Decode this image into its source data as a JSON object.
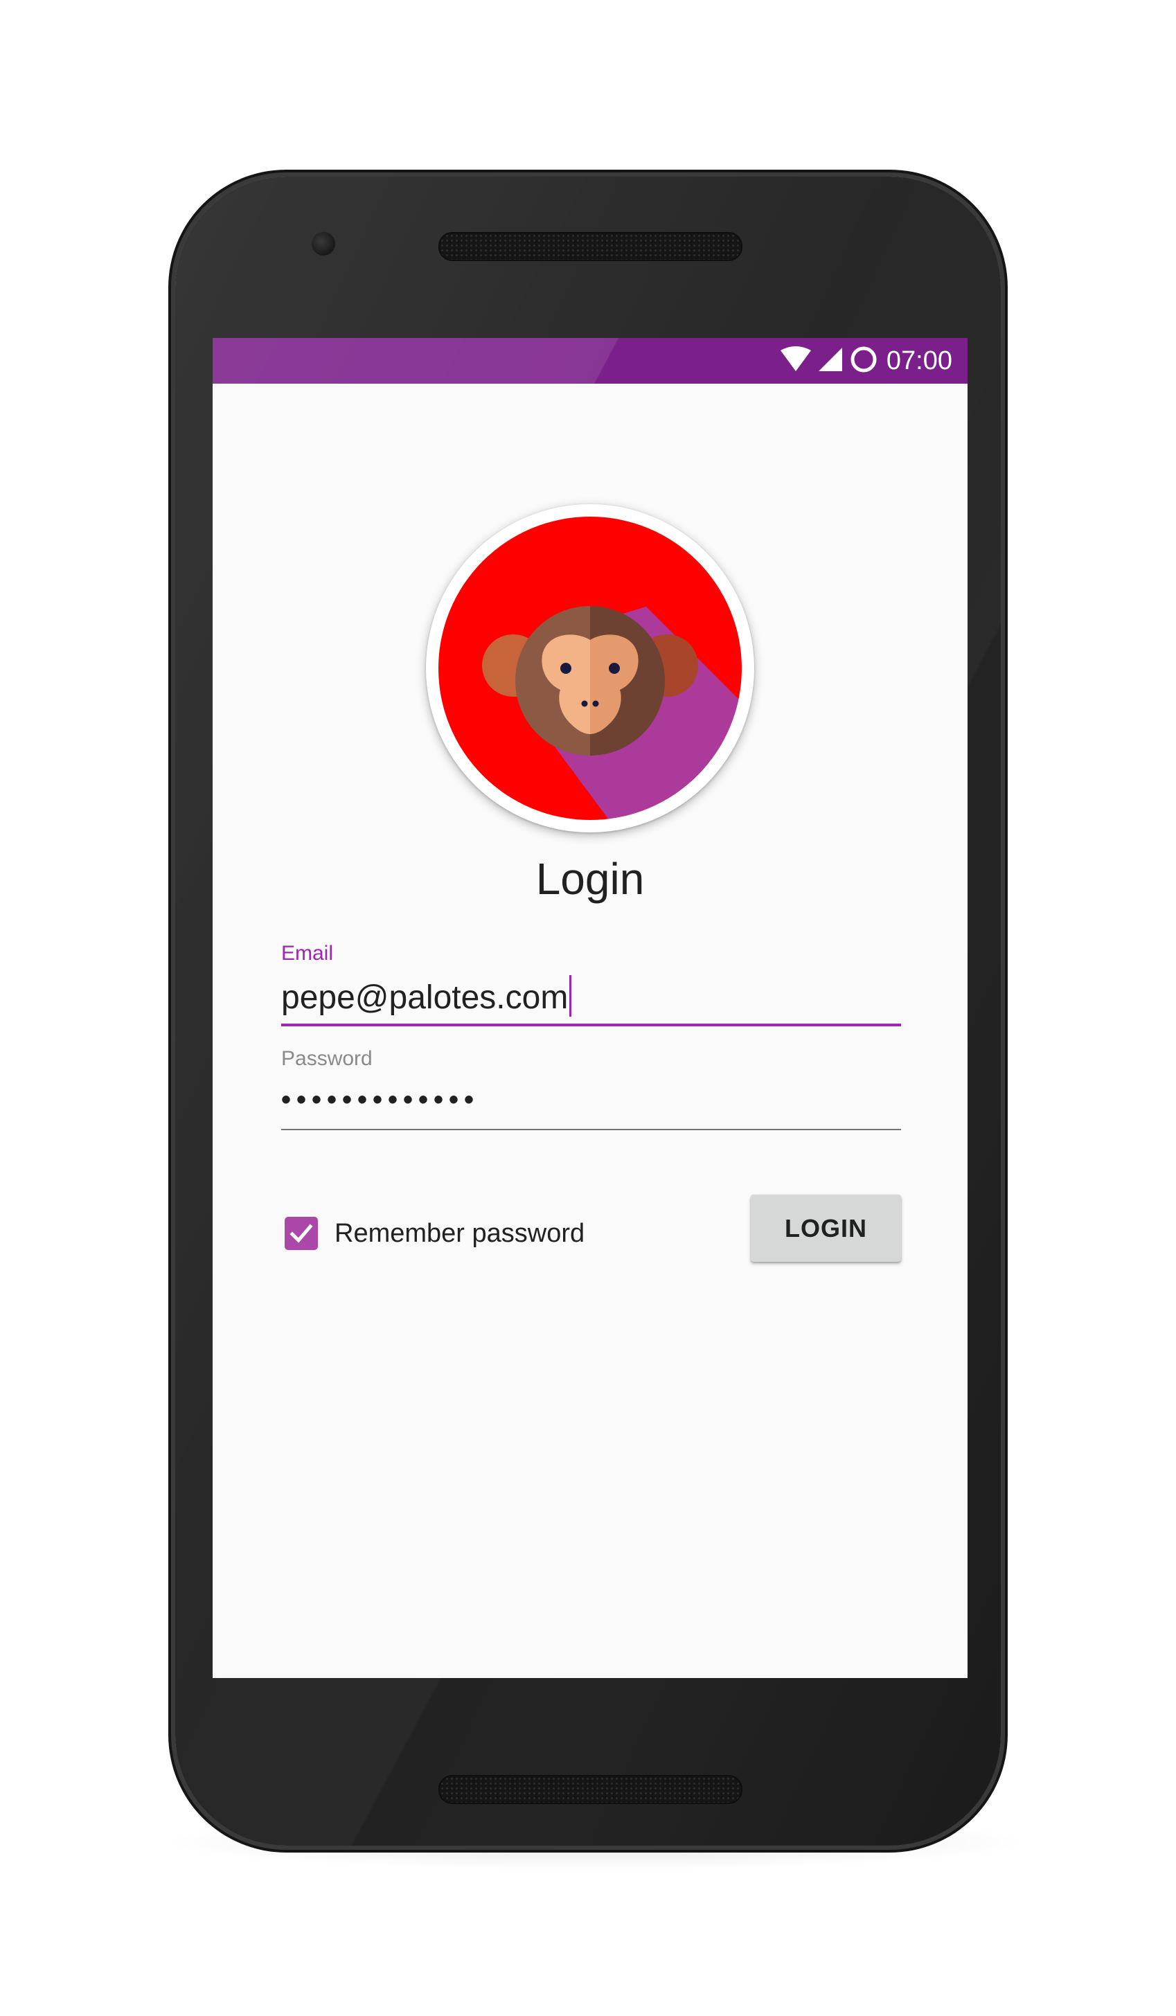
{
  "status_bar": {
    "time": "07:00",
    "icons": [
      "wifi-icon",
      "cell-signal-icon",
      "circle-icon"
    ],
    "color": "#7b1f8a"
  },
  "avatar": {
    "icon": "monkey-icon",
    "background_color": "#ff0000",
    "shadow_color": "#ab3a9a"
  },
  "login": {
    "title": "Login",
    "email": {
      "label": "Email",
      "value": "pepe@palotes.com"
    },
    "password": {
      "label": "Password",
      "value": "•••••••••••••"
    },
    "remember": {
      "label": "Remember password",
      "checked": true
    },
    "button_label": "LOGIN"
  },
  "colors": {
    "accent": "#9c27b0",
    "checkbox": "#ab47a8",
    "button_bg": "#d6d7d7"
  }
}
